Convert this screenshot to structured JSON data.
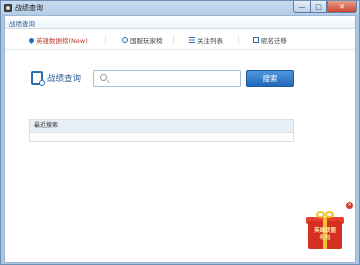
{
  "window": {
    "title": "战绩查询",
    "controls": {
      "minimize": "—",
      "maximize": "□",
      "close": "✕"
    }
  },
  "tab": {
    "label": "战绩查询"
  },
  "nav": {
    "items": [
      {
        "label": "英雄数据榜(New)",
        "icon": "pin-icon",
        "active": true
      },
      {
        "label": "国服玩家榜",
        "icon": "globe-icon",
        "active": false
      },
      {
        "label": "关注列表",
        "icon": "list-icon",
        "active": false
      },
      {
        "label": "昵名迁移",
        "icon": "transfer-icon",
        "active": false
      }
    ]
  },
  "search": {
    "title": "战绩查询",
    "input_value": "",
    "placeholder": "",
    "button_label": "搜索"
  },
  "recent": {
    "header": "最近搜索"
  },
  "gift": {
    "text_line1": "英雄联盟",
    "text_line2": "礼包",
    "close": "×"
  },
  "colors": {
    "accent": "#2d6db4",
    "active_nav": "#c0392b",
    "gift_red": "#d42f1f"
  }
}
